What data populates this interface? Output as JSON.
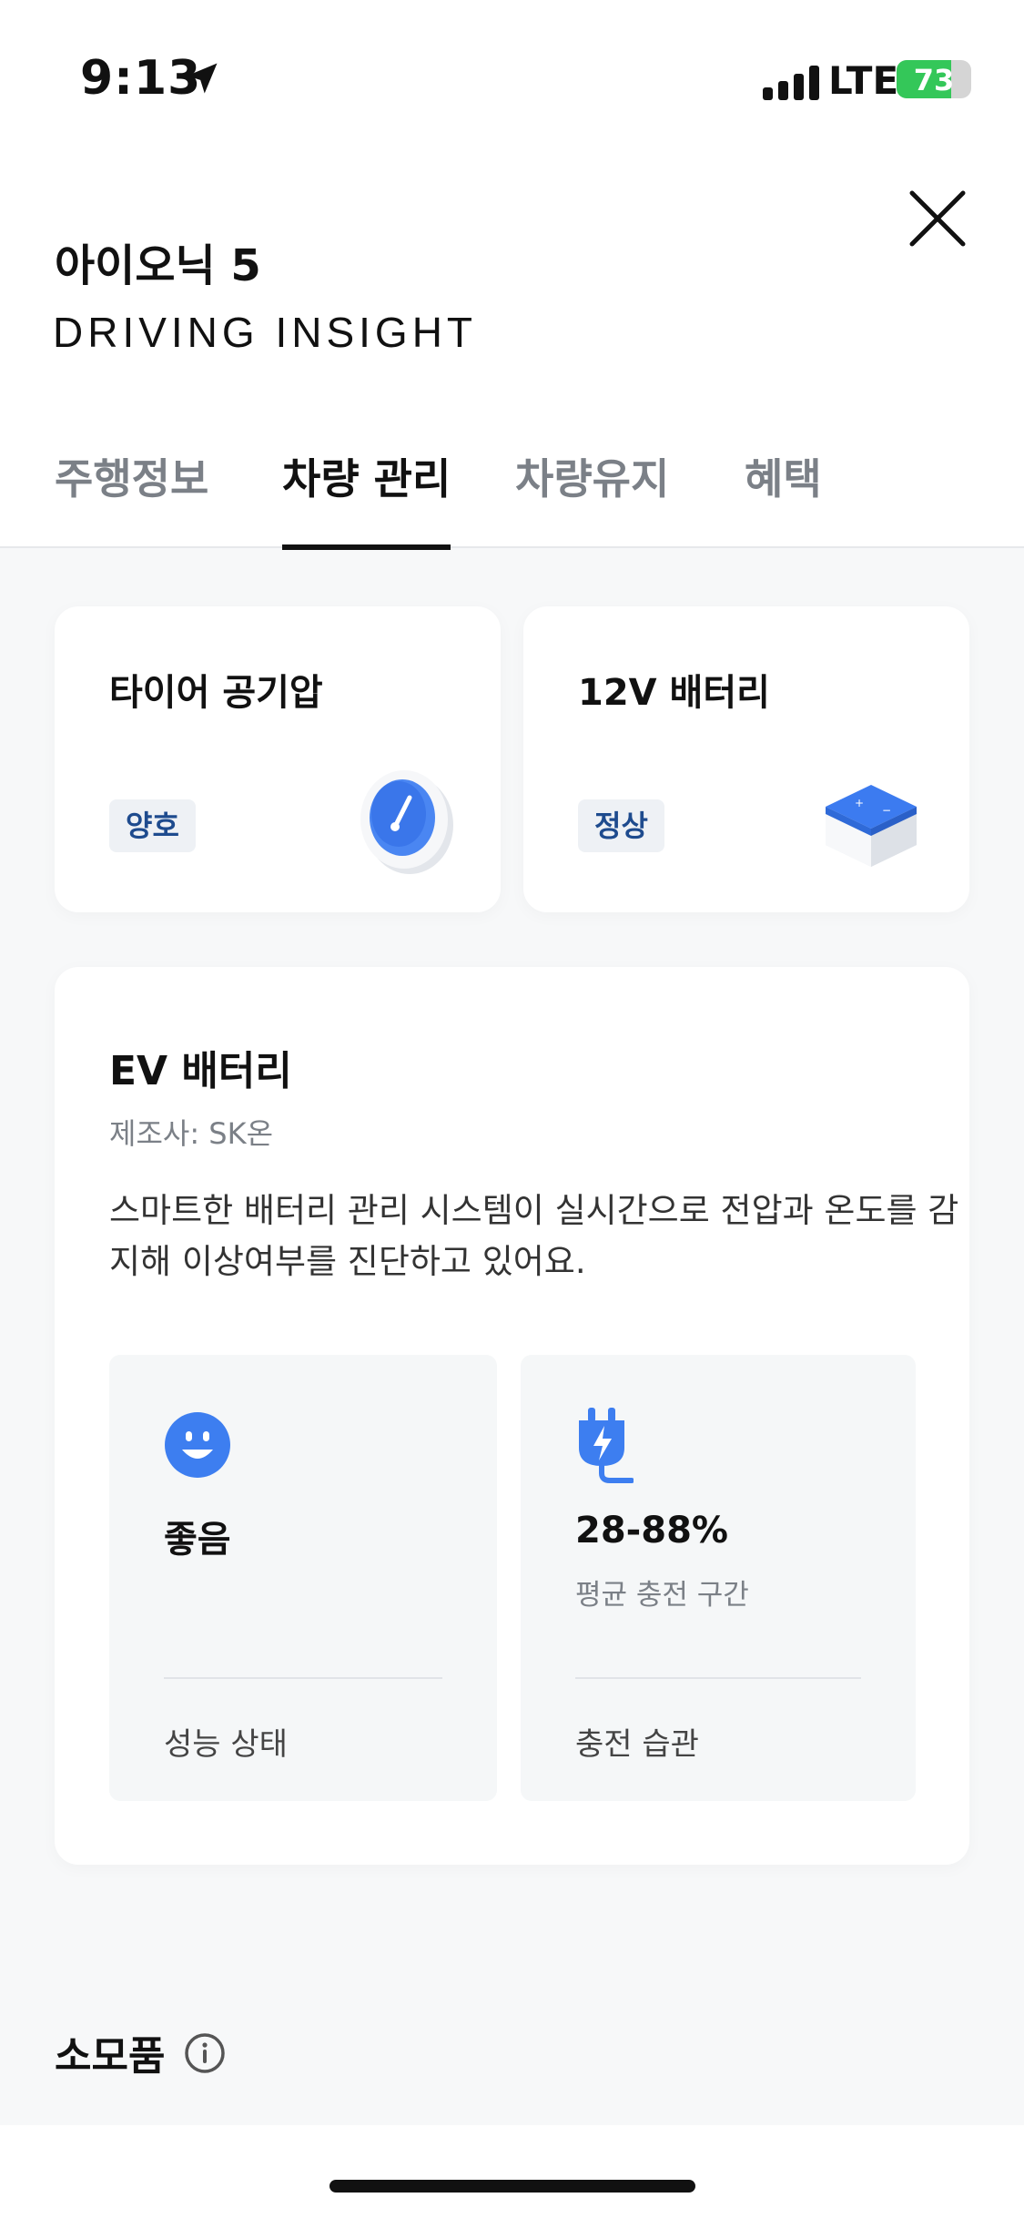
{
  "status_bar": {
    "time": "9:13",
    "network": "LTE",
    "battery": "73",
    "battery_level": 0.73,
    "battery_color": "#34c759"
  },
  "header": {
    "vehicle": "아이오닉 5",
    "brand": "DRIVING INSIGHT",
    "close_icon": "close-icon"
  },
  "tabs": [
    {
      "label": "주행정보",
      "active": false
    },
    {
      "label": "차량 관리",
      "active": true
    },
    {
      "label": "차량유지",
      "active": false
    },
    {
      "label": "혜택",
      "active": false
    }
  ],
  "cards": {
    "tire": {
      "title": "타이어 공기압",
      "status": "양호",
      "icon": "tire-gauge-icon"
    },
    "battery12v": {
      "title": "12V 배터리",
      "status": "정상",
      "icon": "battery-12v-icon"
    }
  },
  "ev_battery": {
    "title": "EV 배터리",
    "maker": "제조사: SK온",
    "description": "스마트한 배터리 관리 시스템이 실시간으로 전압과 온도를 감지해 이상여부를 진단하고 있어요.",
    "performance": {
      "value": "좋음",
      "label": "성능 상태",
      "icon": "smile-face-icon"
    },
    "charging": {
      "value": "28-88%",
      "caption": "평균 충전 구간",
      "label": "충전 습관",
      "icon": "charging-plug-icon"
    }
  },
  "accessories": {
    "title": "소모품",
    "icon": "info-icon"
  },
  "colors": {
    "accent": "#3d7ef0",
    "badge_text": "#1e4b8e",
    "background": "#f7f8f9"
  }
}
